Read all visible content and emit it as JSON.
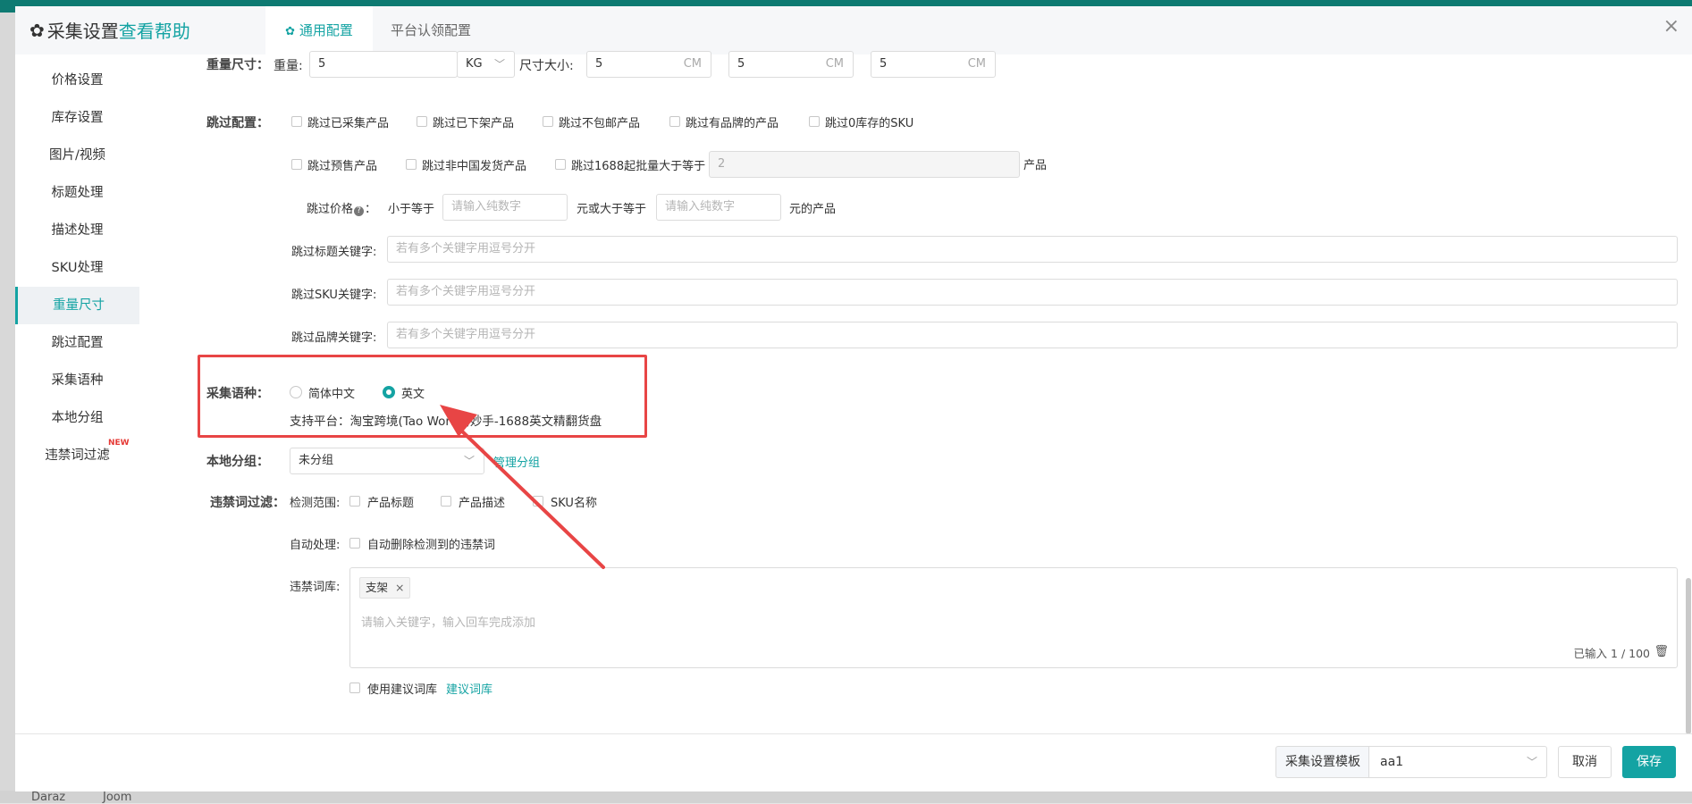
{
  "bottom_bg": {
    "left": "Daraz",
    "right": "Joom"
  },
  "header": {
    "title": "采集设置",
    "help_link": "查看帮助",
    "tabs": [
      {
        "label": "通用配置"
      },
      {
        "label": "平台认领配置"
      }
    ],
    "close_label": "×"
  },
  "sidebar": {
    "items": [
      {
        "label": "价格设置"
      },
      {
        "label": "库存设置"
      },
      {
        "label": "图片/视频"
      },
      {
        "label": "标题处理"
      },
      {
        "label": "描述处理"
      },
      {
        "label": "SKU处理"
      },
      {
        "label": "重量尺寸"
      },
      {
        "label": "跳过配置"
      },
      {
        "label": "采集语种"
      },
      {
        "label": "本地分组"
      },
      {
        "label": "违禁词过滤"
      }
    ],
    "new_badge": "NEW"
  },
  "weight": {
    "label": "重量尺寸：",
    "weight_label": "重量:",
    "weight_value": "5",
    "unit_select": "KG",
    "size_label": "尺寸大小:",
    "dims": [
      {
        "value": "5"
      },
      {
        "value": "5"
      },
      {
        "value": "5"
      }
    ],
    "dim_unit": "CM"
  },
  "skip": {
    "label": "跳过配置：",
    "row1": [
      {
        "label": "跳过已采集产品"
      },
      {
        "label": "跳过已下架产品"
      },
      {
        "label": "跳过不包邮产品"
      },
      {
        "label": "跳过有品牌的产品"
      },
      {
        "label": "跳过0库存的SKU"
      }
    ],
    "row2": [
      {
        "label": "跳过预售产品"
      },
      {
        "label": "跳过非中国发货产品"
      },
      {
        "label": "跳过1688起批量大于等于"
      }
    ],
    "moq_value": "2",
    "moq_suffix": "产品",
    "price_label": "跳过价格",
    "price_help_icon": "?",
    "price_colon": "：",
    "less_than": "小于等于",
    "price_placeholder": "请输入纯数字",
    "or_greater": "元或大于等于",
    "price_suffix": "元的产品",
    "title_kw_label": "跳过标题关键字:",
    "sku_kw_label": "跳过SKU关键字:",
    "brand_kw_label": "跳过品牌关键字:",
    "kw_placeholder": "若有多个关键字用逗号分开"
  },
  "language": {
    "label": "采集语种：",
    "options": [
      {
        "label": "简体中文",
        "selected": false
      },
      {
        "label": "英文",
        "selected": true
      }
    ],
    "support": "支持平台：淘宝跨境(Tao World),妙手-1688英文精翻货盘"
  },
  "group": {
    "label": "本地分组：",
    "value": "未分组",
    "manage": "管理分组"
  },
  "filter": {
    "label": "违禁词过滤：",
    "scope_label": "检测范围:",
    "scope_options": [
      {
        "label": "产品标题"
      },
      {
        "label": "产品描述"
      },
      {
        "label": "SKU名称"
      }
    ],
    "auto_label": "自动处理:",
    "auto_option": "自动删除检测到的违禁词",
    "lib_label": "违禁词库:",
    "tags": [
      {
        "label": "支架"
      }
    ],
    "tag_close": "×",
    "lib_placeholder": "请输入关键字，输入回车完成添加",
    "count": "已输入 1 / 100",
    "use_suggest": "使用建议词库",
    "suggest_link": "建议词库"
  },
  "footer": {
    "template_label": "采集设置模板",
    "template_value": "aa1",
    "cancel": "取消",
    "save": "保存"
  },
  "colors": {
    "accent": "#14a3a3",
    "annotation": "#e84545"
  }
}
